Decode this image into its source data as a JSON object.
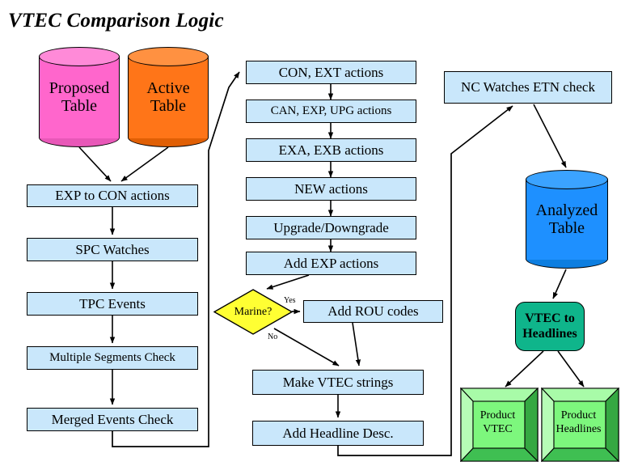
{
  "diagram": {
    "title": "VTEC Comparison Logic",
    "colors": {
      "process_fill": "#c9e7fb",
      "proposed_table_fill": "#ff66cc",
      "active_table_fill": "#ff7518",
      "analyzed_table_fill": "#1e90ff",
      "decision_fill": "#ffff33",
      "headline_box_fill": "#0fb58b",
      "product_box_fill": "#7df77d",
      "stroke": "#000000"
    },
    "nodes": {
      "proposed_table": {
        "label_line1": "Proposed",
        "label_line2": "Table",
        "shape": "cylinder"
      },
      "active_table": {
        "label_line1": "Active",
        "label_line2": "Table",
        "shape": "cylinder"
      },
      "analyzed_table": {
        "label_line1": "Analyzed",
        "label_line2": "Table",
        "shape": "cylinder"
      },
      "exp_to_con": {
        "label": "EXP to CON actions",
        "shape": "process"
      },
      "spc_watches": {
        "label": "SPC Watches",
        "shape": "process"
      },
      "tpc_events": {
        "label": "TPC Events",
        "shape": "process"
      },
      "multiple_segments_check": {
        "label": "Multiple Segments Check",
        "shape": "process"
      },
      "merged_events_check": {
        "label": "Merged Events Check",
        "shape": "process"
      },
      "con_ext": {
        "label": "CON, EXT actions",
        "shape": "process"
      },
      "can_exp_upg": {
        "label": "CAN, EXP, UPG actions",
        "shape": "process"
      },
      "exa_exb": {
        "label": "EXA, EXB actions",
        "shape": "process"
      },
      "new_actions": {
        "label": "NEW actions",
        "shape": "process"
      },
      "upgrade_downgrade": {
        "label": "Upgrade/Downgrade",
        "shape": "process"
      },
      "add_exp_actions": {
        "label": "Add EXP actions",
        "shape": "process"
      },
      "marine_decision": {
        "label": "Marine?",
        "shape": "decision"
      },
      "add_rou_codes": {
        "label": "Add ROU codes",
        "shape": "process"
      },
      "make_vtec_strings": {
        "label": "Make VTEC strings",
        "shape": "process"
      },
      "add_headline_desc": {
        "label": "Add Headline Desc.",
        "shape": "process"
      },
      "nc_watches_etn": {
        "label": "NC Watches ETN check",
        "shape": "process"
      },
      "vtec_to_headlines": {
        "label_line1": "VTEC to",
        "label_line2": "Headlines",
        "shape": "rounded"
      },
      "product_vtec": {
        "label_line1": "Product",
        "label_line2": "VTEC",
        "shape": "cube"
      },
      "product_headlines": {
        "label_line1": "Product",
        "label_line2": "Headlines",
        "shape": "cube"
      }
    },
    "edge_labels": {
      "marine_yes": "Yes",
      "marine_no": "No"
    }
  }
}
